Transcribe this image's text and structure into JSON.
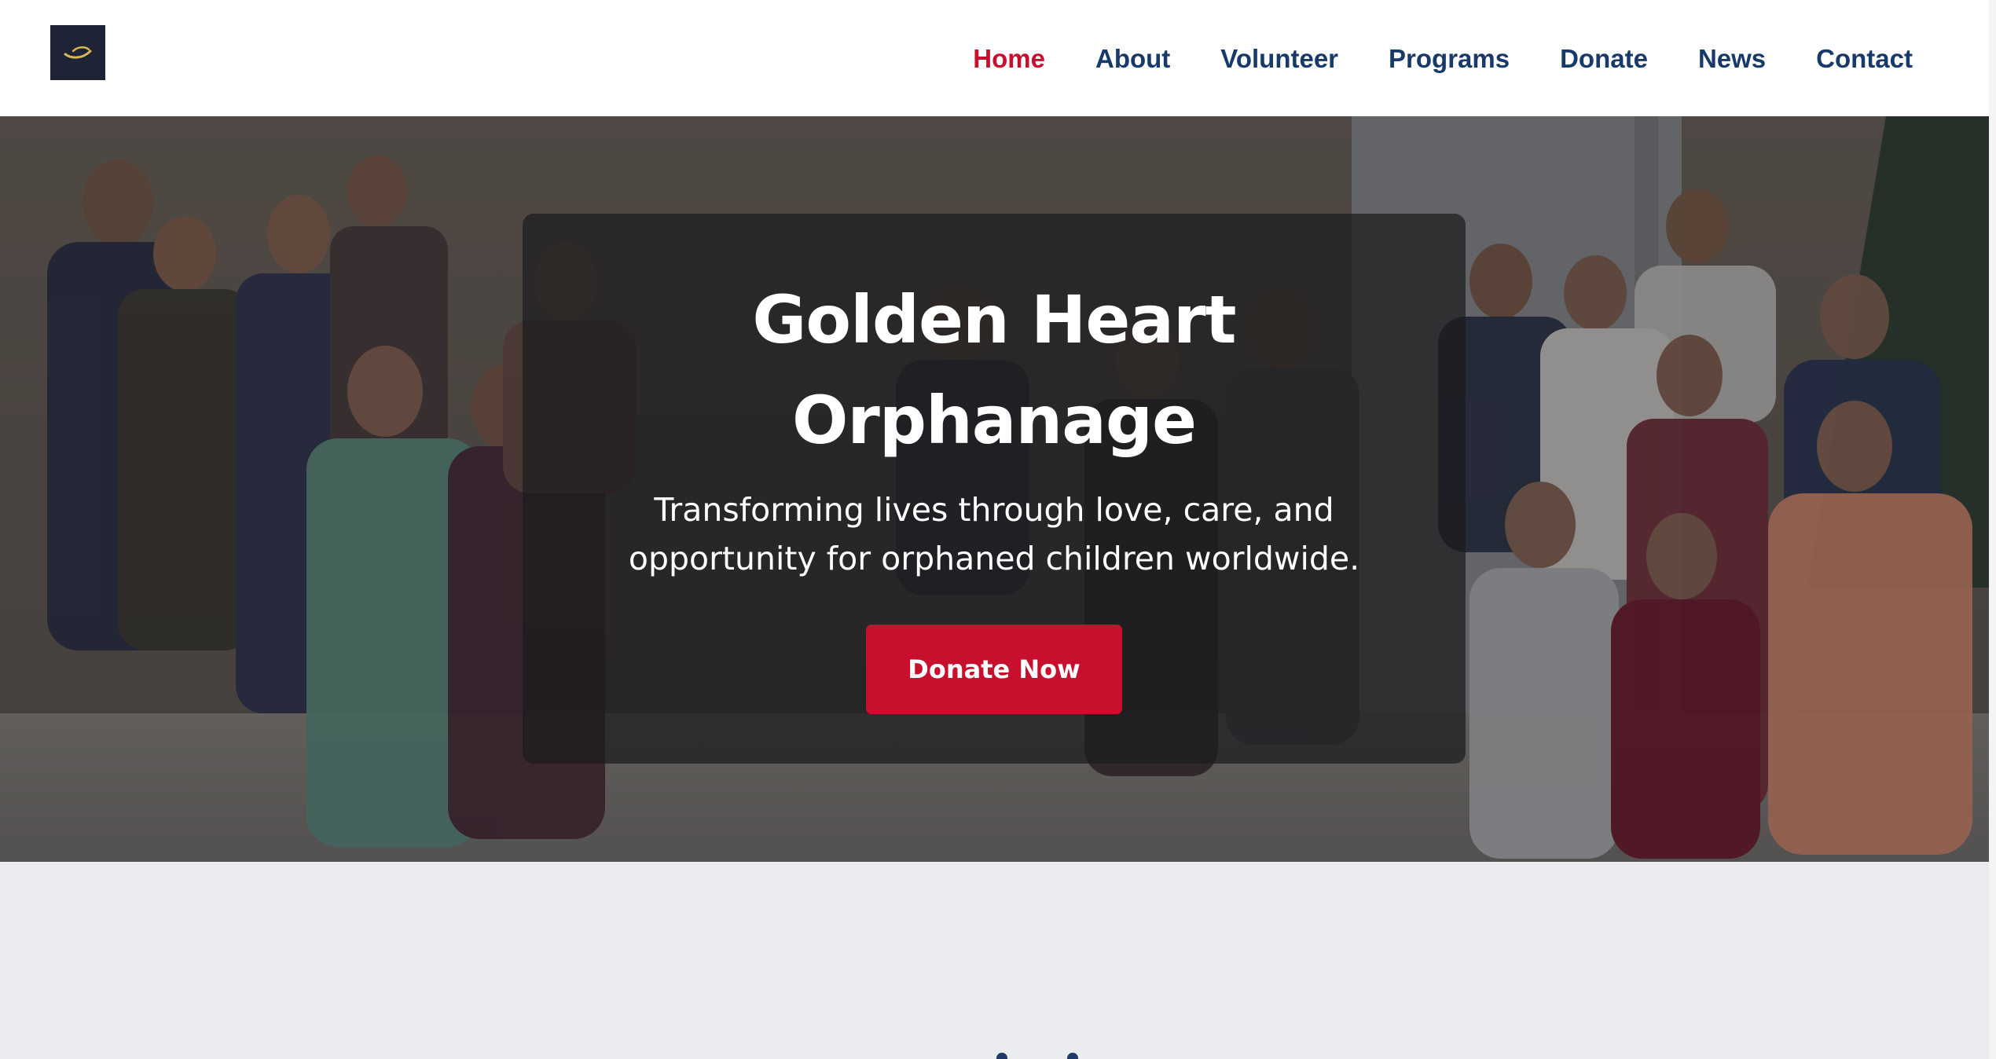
{
  "header": {
    "logo_alt": "Golden Heart logo",
    "nav": [
      {
        "label": "Home",
        "active": true
      },
      {
        "label": "About",
        "active": false
      },
      {
        "label": "Volunteer",
        "active": false
      },
      {
        "label": "Programs",
        "active": false
      },
      {
        "label": "Donate",
        "active": false
      },
      {
        "label": "News",
        "active": false
      },
      {
        "label": "Contact",
        "active": false
      }
    ]
  },
  "hero": {
    "title_line1": "Golden Heart",
    "title_line2": "Orphanage",
    "subtitle_line1": "Transforming lives through love, care, and",
    "subtitle_line2": "opportunity for orphaned children worldwide.",
    "cta_label": "Donate Now"
  },
  "colors": {
    "accent": "#c8102e",
    "nav_text": "#173a6b",
    "logo_bg": "#1e2436",
    "section_bg": "#e9ebef"
  },
  "icons": {
    "logo": "logo-swoosh-icon"
  }
}
